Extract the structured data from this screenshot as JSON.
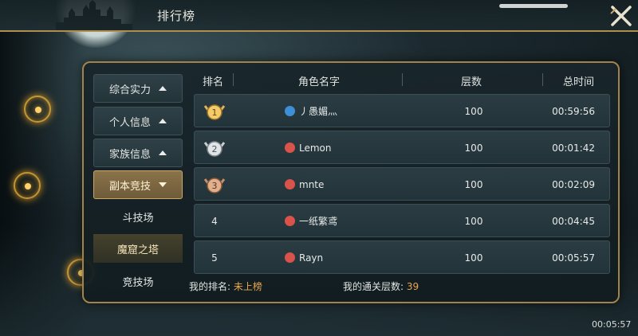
{
  "header": {
    "title": "排行榜"
  },
  "sidebar": {
    "items": [
      {
        "label": "综合实力"
      },
      {
        "label": "个人信息"
      },
      {
        "label": "家族信息"
      },
      {
        "label": "副本竞技"
      }
    ],
    "subitems": [
      {
        "label": "斗技场"
      },
      {
        "label": "魔窟之塔"
      },
      {
        "label": "竞技场"
      }
    ]
  },
  "table": {
    "columns": [
      "排名",
      "角色名字",
      "层数",
      "总时间"
    ],
    "rows": [
      {
        "rank": "1",
        "rank_icon": "gold-medal-icon",
        "class_icon": "water-class-icon",
        "name": "丿愚媚灬",
        "floor": "100",
        "time": "00:59:56"
      },
      {
        "rank": "2",
        "rank_icon": "silver-medal-icon",
        "class_icon": "fire-class-icon",
        "name": "Lemon",
        "floor": "100",
        "time": "00:01:42"
      },
      {
        "rank": "3",
        "rank_icon": "bronze-medal-icon",
        "class_icon": "fire-class-icon",
        "name": "mnte",
        "floor": "100",
        "time": "00:02:09"
      },
      {
        "rank": "4",
        "class_icon": "fire-class-icon",
        "name": "一纸繁鸢",
        "floor": "100",
        "time": "00:04:45"
      },
      {
        "rank": "5",
        "class_icon": "fire-class-icon",
        "name": "Rayn",
        "floor": "100",
        "time": "00:05:57"
      }
    ]
  },
  "footer": {
    "my_rank_label": "我的排名:",
    "my_rank_value": "未上榜",
    "my_floor_label": "我的通关层数:",
    "my_floor_value": "39"
  },
  "clock": "00:05:57",
  "colors": {
    "accent_gold": "#b08f4e",
    "highlight_orange": "#e9a64e",
    "water": "#3d8fd8",
    "fire": "#d9534a"
  }
}
